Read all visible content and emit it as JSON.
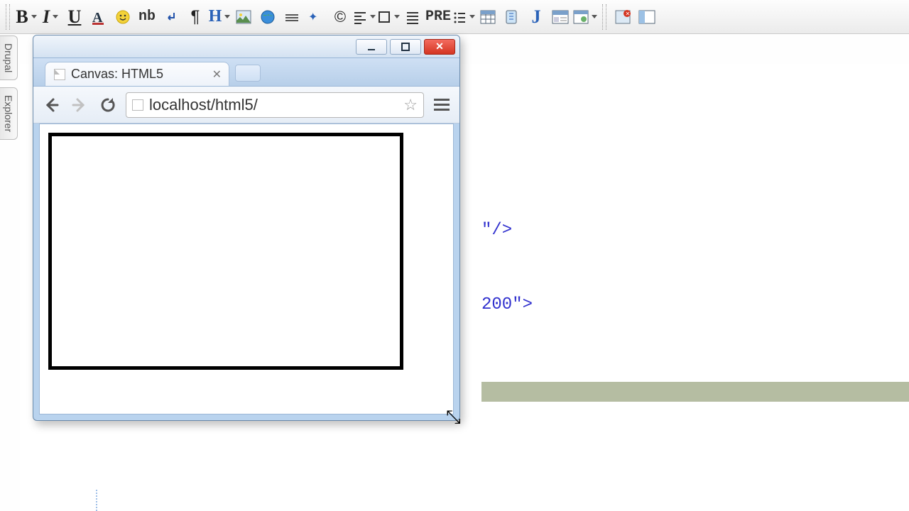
{
  "toolbar": {
    "nb_label": "nb",
    "pre_label": "PRE"
  },
  "side_tabs": {
    "t1": "Drupal",
    "t2": "Explorer"
  },
  "code": {
    "frag1": "\"/>",
    "frag2": "200\">"
  },
  "browser": {
    "tab_title": "Canvas: HTML5",
    "url": "localhost/html5/"
  }
}
